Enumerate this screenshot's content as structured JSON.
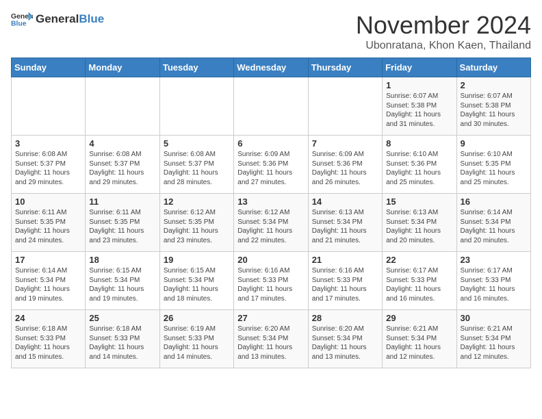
{
  "header": {
    "logo_general": "General",
    "logo_blue": "Blue",
    "month_year": "November 2024",
    "location": "Ubonratana, Khon Kaen, Thailand"
  },
  "days_of_week": [
    "Sunday",
    "Monday",
    "Tuesday",
    "Wednesday",
    "Thursday",
    "Friday",
    "Saturday"
  ],
  "weeks": [
    [
      {
        "day": "",
        "info": ""
      },
      {
        "day": "",
        "info": ""
      },
      {
        "day": "",
        "info": ""
      },
      {
        "day": "",
        "info": ""
      },
      {
        "day": "",
        "info": ""
      },
      {
        "day": "1",
        "info": "Sunrise: 6:07 AM\nSunset: 5:38 PM\nDaylight: 11 hours and 31 minutes."
      },
      {
        "day": "2",
        "info": "Sunrise: 6:07 AM\nSunset: 5:38 PM\nDaylight: 11 hours and 30 minutes."
      }
    ],
    [
      {
        "day": "3",
        "info": "Sunrise: 6:08 AM\nSunset: 5:37 PM\nDaylight: 11 hours and 29 minutes."
      },
      {
        "day": "4",
        "info": "Sunrise: 6:08 AM\nSunset: 5:37 PM\nDaylight: 11 hours and 29 minutes."
      },
      {
        "day": "5",
        "info": "Sunrise: 6:08 AM\nSunset: 5:37 PM\nDaylight: 11 hours and 28 minutes."
      },
      {
        "day": "6",
        "info": "Sunrise: 6:09 AM\nSunset: 5:36 PM\nDaylight: 11 hours and 27 minutes."
      },
      {
        "day": "7",
        "info": "Sunrise: 6:09 AM\nSunset: 5:36 PM\nDaylight: 11 hours and 26 minutes."
      },
      {
        "day": "8",
        "info": "Sunrise: 6:10 AM\nSunset: 5:36 PM\nDaylight: 11 hours and 25 minutes."
      },
      {
        "day": "9",
        "info": "Sunrise: 6:10 AM\nSunset: 5:35 PM\nDaylight: 11 hours and 25 minutes."
      }
    ],
    [
      {
        "day": "10",
        "info": "Sunrise: 6:11 AM\nSunset: 5:35 PM\nDaylight: 11 hours and 24 minutes."
      },
      {
        "day": "11",
        "info": "Sunrise: 6:11 AM\nSunset: 5:35 PM\nDaylight: 11 hours and 23 minutes."
      },
      {
        "day": "12",
        "info": "Sunrise: 6:12 AM\nSunset: 5:35 PM\nDaylight: 11 hours and 23 minutes."
      },
      {
        "day": "13",
        "info": "Sunrise: 6:12 AM\nSunset: 5:34 PM\nDaylight: 11 hours and 22 minutes."
      },
      {
        "day": "14",
        "info": "Sunrise: 6:13 AM\nSunset: 5:34 PM\nDaylight: 11 hours and 21 minutes."
      },
      {
        "day": "15",
        "info": "Sunrise: 6:13 AM\nSunset: 5:34 PM\nDaylight: 11 hours and 20 minutes."
      },
      {
        "day": "16",
        "info": "Sunrise: 6:14 AM\nSunset: 5:34 PM\nDaylight: 11 hours and 20 minutes."
      }
    ],
    [
      {
        "day": "17",
        "info": "Sunrise: 6:14 AM\nSunset: 5:34 PM\nDaylight: 11 hours and 19 minutes."
      },
      {
        "day": "18",
        "info": "Sunrise: 6:15 AM\nSunset: 5:34 PM\nDaylight: 11 hours and 19 minutes."
      },
      {
        "day": "19",
        "info": "Sunrise: 6:15 AM\nSunset: 5:34 PM\nDaylight: 11 hours and 18 minutes."
      },
      {
        "day": "20",
        "info": "Sunrise: 6:16 AM\nSunset: 5:33 PM\nDaylight: 11 hours and 17 minutes."
      },
      {
        "day": "21",
        "info": "Sunrise: 6:16 AM\nSunset: 5:33 PM\nDaylight: 11 hours and 17 minutes."
      },
      {
        "day": "22",
        "info": "Sunrise: 6:17 AM\nSunset: 5:33 PM\nDaylight: 11 hours and 16 minutes."
      },
      {
        "day": "23",
        "info": "Sunrise: 6:17 AM\nSunset: 5:33 PM\nDaylight: 11 hours and 16 minutes."
      }
    ],
    [
      {
        "day": "24",
        "info": "Sunrise: 6:18 AM\nSunset: 5:33 PM\nDaylight: 11 hours and 15 minutes."
      },
      {
        "day": "25",
        "info": "Sunrise: 6:18 AM\nSunset: 5:33 PM\nDaylight: 11 hours and 14 minutes."
      },
      {
        "day": "26",
        "info": "Sunrise: 6:19 AM\nSunset: 5:33 PM\nDaylight: 11 hours and 14 minutes."
      },
      {
        "day": "27",
        "info": "Sunrise: 6:20 AM\nSunset: 5:34 PM\nDaylight: 11 hours and 13 minutes."
      },
      {
        "day": "28",
        "info": "Sunrise: 6:20 AM\nSunset: 5:34 PM\nDaylight: 11 hours and 13 minutes."
      },
      {
        "day": "29",
        "info": "Sunrise: 6:21 AM\nSunset: 5:34 PM\nDaylight: 11 hours and 12 minutes."
      },
      {
        "day": "30",
        "info": "Sunrise: 6:21 AM\nSunset: 5:34 PM\nDaylight: 11 hours and 12 minutes."
      }
    ]
  ]
}
